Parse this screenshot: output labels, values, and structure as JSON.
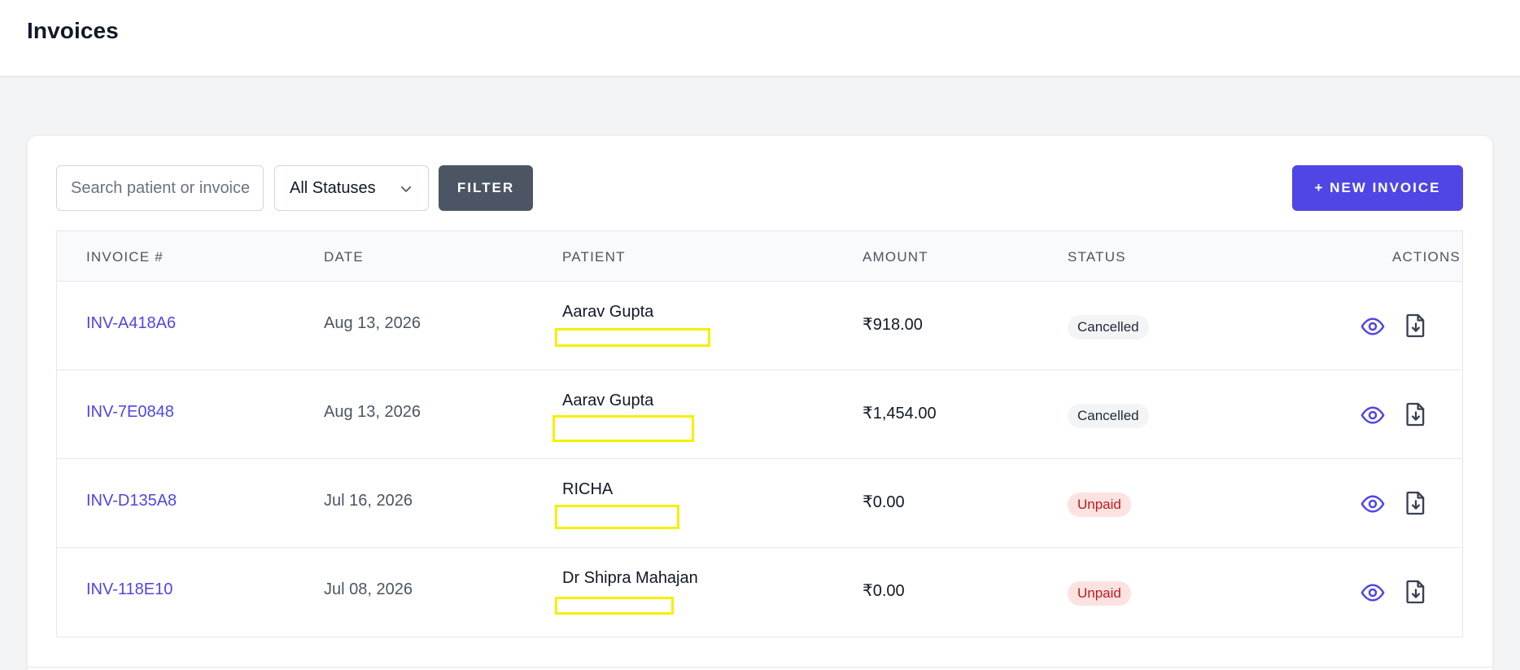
{
  "page": {
    "title": "Invoices"
  },
  "toolbar": {
    "search_placeholder": "Search patient or invoice",
    "status_select": "All Statuses",
    "filter_label": "FILTER",
    "new_invoice_label": "+ NEW INVOICE"
  },
  "table": {
    "headers": {
      "invoice": "INVOICE #",
      "date": "DATE",
      "patient": "PATIENT",
      "amount": "AMOUNT",
      "status": "STATUS",
      "actions": "ACTIONS"
    },
    "rows": [
      {
        "invoice": "INV-A418A6",
        "date": "Aug 13, 2026",
        "patient": "Aarav Gupta",
        "amount": "₹918.00",
        "status": "Cancelled"
      },
      {
        "invoice": "INV-7E0848",
        "date": "Aug 13, 2026",
        "patient": "Aarav Gupta",
        "amount": "₹1,454.00",
        "status": "Cancelled"
      },
      {
        "invoice": "INV-D135A8",
        "date": "Jul 16, 2026",
        "patient": "RICHA",
        "amount": "₹0.00",
        "status": "Unpaid"
      },
      {
        "invoice": "INV-118E10",
        "date": "Jul 08, 2026",
        "patient": "Dr Shipra Mahajan",
        "amount": "₹0.00",
        "status": "Unpaid"
      }
    ]
  },
  "colors": {
    "accent": "#4f46e5",
    "filter_button": "#4b5563",
    "highlight_box": "#f7ef00",
    "unpaid_badge_bg": "#fee2e2",
    "unpaid_badge_text": "#b91c1c",
    "cancelled_badge_bg": "#f3f4f6"
  },
  "icons": {
    "select_chevron": "chevron-down-icon",
    "view_action": "eye-icon",
    "download_action": "file-download-icon"
  }
}
